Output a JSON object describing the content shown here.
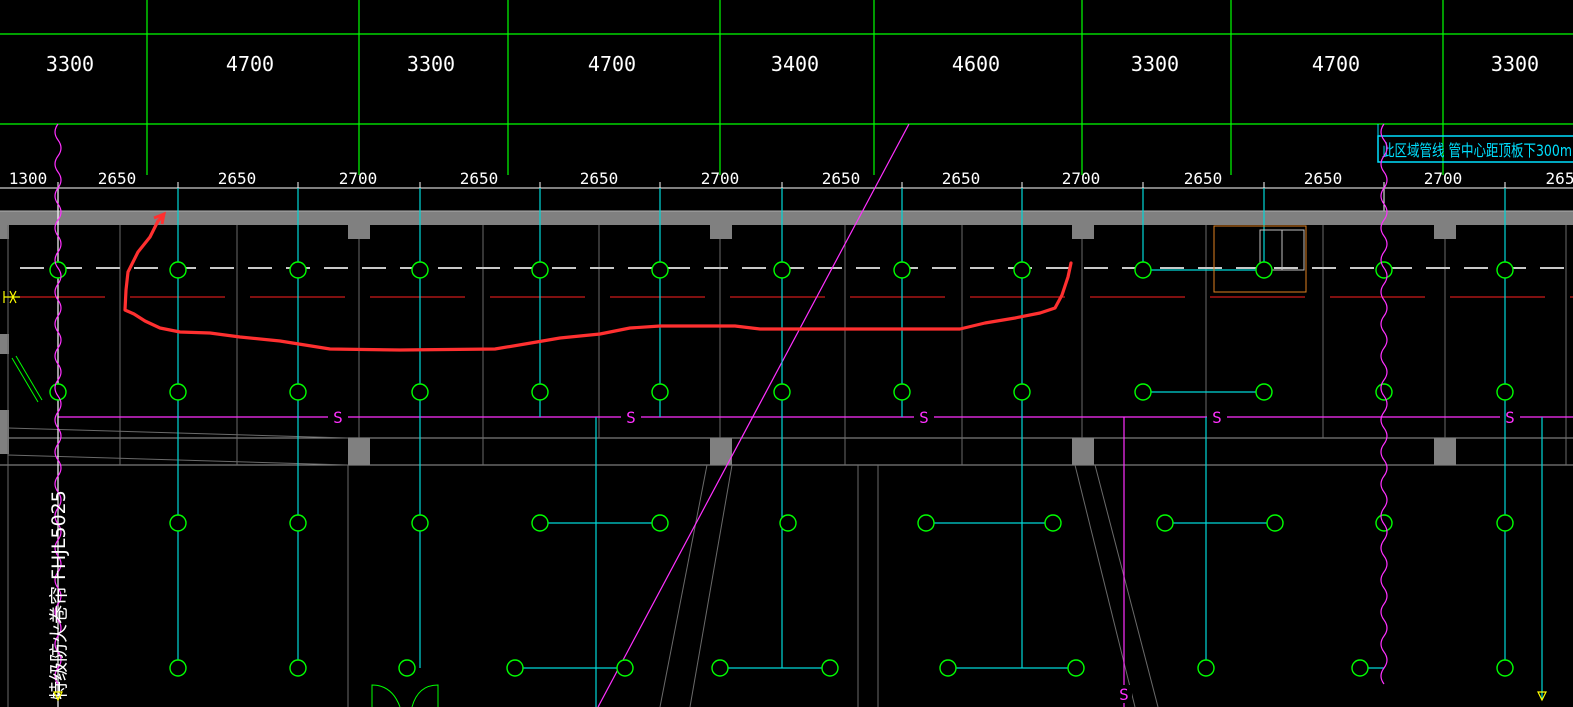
{
  "drawing": {
    "top_dimensions": [
      "3300",
      "4700",
      "3300",
      "4700",
      "3400",
      "4600",
      "3300",
      "4700",
      "3300"
    ],
    "bottom_dimensions": [
      "1300",
      "2650",
      "2650",
      "2700",
      "2650",
      "2650",
      "2700",
      "2650",
      "2650",
      "2700",
      "2650",
      "2650",
      "2700",
      "265"
    ],
    "zone_note": "此区域管线  管中心距顶板下300m",
    "fire_curtain_label": "特级防火卷帘 FHJL5025",
    "pipe_label": "S",
    "colors": {
      "background": "#000000",
      "grid": "#00ff00",
      "sprinkler": "#00ff00",
      "pipe": "#00d8d8",
      "magenta_line": "#ff30ff",
      "red_markup": "#ff3030",
      "structure": "#808080",
      "text": "#ffffff",
      "note": "#00e0ff"
    }
  }
}
